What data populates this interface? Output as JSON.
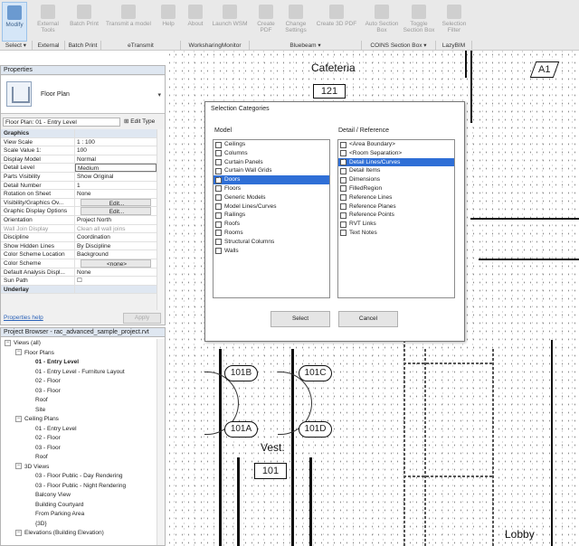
{
  "ribbon": {
    "buttons": [
      {
        "label": "Modify",
        "icon": "cursor-icon",
        "active": true
      },
      {
        "label": "External Tools",
        "icon": "tools-icon"
      },
      {
        "label": "Batch Print",
        "icon": "printer-icon"
      },
      {
        "label": "Transmit a model",
        "icon": "transmit-icon"
      },
      {
        "label": "Help",
        "icon": "help-icon"
      },
      {
        "label": "About",
        "icon": "about-icon"
      },
      {
        "label": "Launch WSM",
        "icon": "wsm-icon"
      },
      {
        "label": "Create PDF",
        "icon": "pdf-icon"
      },
      {
        "label": "Change Settings",
        "icon": "settings-icon"
      },
      {
        "label": "Create 3D PDF",
        "icon": "pdf3d-icon"
      },
      {
        "label": "Auto Section Box",
        "icon": "section-box-icon"
      },
      {
        "label": "Toggle Section Box",
        "icon": "toggle-icon"
      },
      {
        "label": "Selection Filter",
        "icon": "filter-icon"
      }
    ],
    "groups": [
      "Select ▾",
      "External",
      "Batch Print",
      "eTransmit",
      "WorksharingMonitor",
      "Bluebeam ▾",
      "COINS Section Box ▾",
      "LazyBIM"
    ]
  },
  "properties": {
    "title": "Properties",
    "type_name": "Floor Plan",
    "instance": "Floor Plan: 01 - Entry Level",
    "edit_type": "Edit Type",
    "rows": [
      {
        "k": "Graphics",
        "v": "",
        "header": true
      },
      {
        "k": "View Scale",
        "v": "1 : 100"
      },
      {
        "k": "Scale Value    1:",
        "v": "100"
      },
      {
        "k": "Display Model",
        "v": "Normal"
      },
      {
        "k": "Detail Level",
        "v": "Medium",
        "box": true
      },
      {
        "k": "Parts Visibility",
        "v": "Show Original"
      },
      {
        "k": "Detail Number",
        "v": "1"
      },
      {
        "k": "Rotation on Sheet",
        "v": "None"
      },
      {
        "k": "Visibility/Graphics Ov...",
        "v": "Edit...",
        "btn": true
      },
      {
        "k": "Graphic Display Options",
        "v": "Edit...",
        "btn": true
      },
      {
        "k": "Orientation",
        "v": "Project North"
      },
      {
        "k": "Wall Join Display",
        "v": "Clean all wall joins",
        "gray": true
      },
      {
        "k": "Discipline",
        "v": "Coordination"
      },
      {
        "k": "Show Hidden Lines",
        "v": "By Discipline"
      },
      {
        "k": "Color Scheme Location",
        "v": "Background"
      },
      {
        "k": "Color Scheme",
        "v": "<none>",
        "btn": true
      },
      {
        "k": "Default Analysis Displ...",
        "v": "None"
      },
      {
        "k": "Sun Path",
        "v": "☐"
      },
      {
        "k": "Underlay",
        "v": "",
        "header": true
      }
    ],
    "help": "Properties help",
    "apply": "Apply"
  },
  "browser": {
    "title": "Project Browser - rac_advanced_sample_project.rvt",
    "items": [
      {
        "t": "Views (all)",
        "lvl": 0,
        "tg": "−"
      },
      {
        "t": "Floor Plans",
        "lvl": 1,
        "tg": "−"
      },
      {
        "t": "01 - Entry Level",
        "lvl": 2,
        "bold": true
      },
      {
        "t": "01 - Entry Level - Furniture Layout",
        "lvl": 2
      },
      {
        "t": "02 - Floor",
        "lvl": 2
      },
      {
        "t": "03 - Floor",
        "lvl": 2
      },
      {
        "t": "Roof",
        "lvl": 2
      },
      {
        "t": "Site",
        "lvl": 2
      },
      {
        "t": "Ceiling Plans",
        "lvl": 1,
        "tg": "−"
      },
      {
        "t": "01 - Entry Level",
        "lvl": 2
      },
      {
        "t": "02 - Floor",
        "lvl": 2
      },
      {
        "t": "03 - Floor",
        "lvl": 2
      },
      {
        "t": "Roof",
        "lvl": 2
      },
      {
        "t": "3D Views",
        "lvl": 1,
        "tg": "−"
      },
      {
        "t": "03 - Floor Public - Day Rendering",
        "lvl": 2
      },
      {
        "t": "03 - Floor Public - Night Rendering",
        "lvl": 2
      },
      {
        "t": "Balcony View",
        "lvl": 2
      },
      {
        "t": "Building Courtyard",
        "lvl": 2
      },
      {
        "t": "From Parking Area",
        "lvl": 2
      },
      {
        "t": "{3D}",
        "lvl": 2
      },
      {
        "t": "Elevations (Building Elevation)",
        "lvl": 1,
        "tg": "−"
      }
    ]
  },
  "canvas": {
    "labels": {
      "cafeteria": "Cafeteria",
      "vest": "Vest.",
      "lobby": "Lobby",
      "grid": "A1"
    },
    "room_tags": [
      "121",
      "101"
    ],
    "door_tags": [
      "101B",
      "101C",
      "101A",
      "101D"
    ]
  },
  "dialog": {
    "title": "Selection Categories",
    "model_label": "Model",
    "detail_label": "Detail / Reference",
    "model": [
      {
        "t": "Ceilings",
        "c": false
      },
      {
        "t": "Columns",
        "c": false
      },
      {
        "t": "Curtain Panels",
        "c": false
      },
      {
        "t": "Curtain Wall Grids",
        "c": false
      },
      {
        "t": "Doors",
        "c": true,
        "sel": true
      },
      {
        "t": "Floors",
        "c": false
      },
      {
        "t": "Generic Models",
        "c": false
      },
      {
        "t": "Model Lines/Curves",
        "c": false
      },
      {
        "t": "Railings",
        "c": false
      },
      {
        "t": "Roofs",
        "c": false
      },
      {
        "t": "Rooms",
        "c": false
      },
      {
        "t": "Structural Columns",
        "c": false
      },
      {
        "t": "Walls",
        "c": false
      }
    ],
    "detail": [
      {
        "t": "<Area Boundary>",
        "c": false
      },
      {
        "t": "<Room Separation>",
        "c": false
      },
      {
        "t": "Detail Lines/Curves",
        "c": true,
        "sel": true
      },
      {
        "t": "Detail Items",
        "c": false
      },
      {
        "t": "Dimensions",
        "c": false
      },
      {
        "t": "FilledRegion",
        "c": false
      },
      {
        "t": "Reference Lines",
        "c": false
      },
      {
        "t": "Reference Planes",
        "c": false
      },
      {
        "t": "Reference Points",
        "c": false
      },
      {
        "t": "RVT Links",
        "c": false
      },
      {
        "t": "Text Notes",
        "c": false
      }
    ],
    "select": "Select",
    "cancel": "Cancel"
  }
}
